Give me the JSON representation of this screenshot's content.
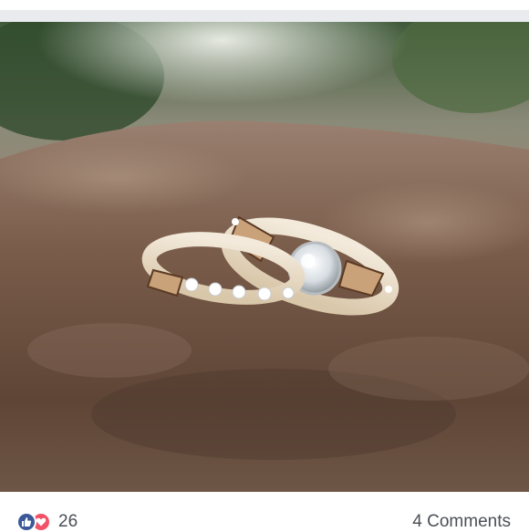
{
  "colors": {
    "top_strip": "#e9ebee",
    "like": "#3b5998",
    "love": "#f25268",
    "text": "#4b4f56"
  },
  "photo": {
    "subject": "two-rings-on-rock"
  },
  "footer": {
    "reaction_icons": [
      "like-icon",
      "love-icon"
    ],
    "reaction_count": "26",
    "comments_label": "4 Comments"
  }
}
